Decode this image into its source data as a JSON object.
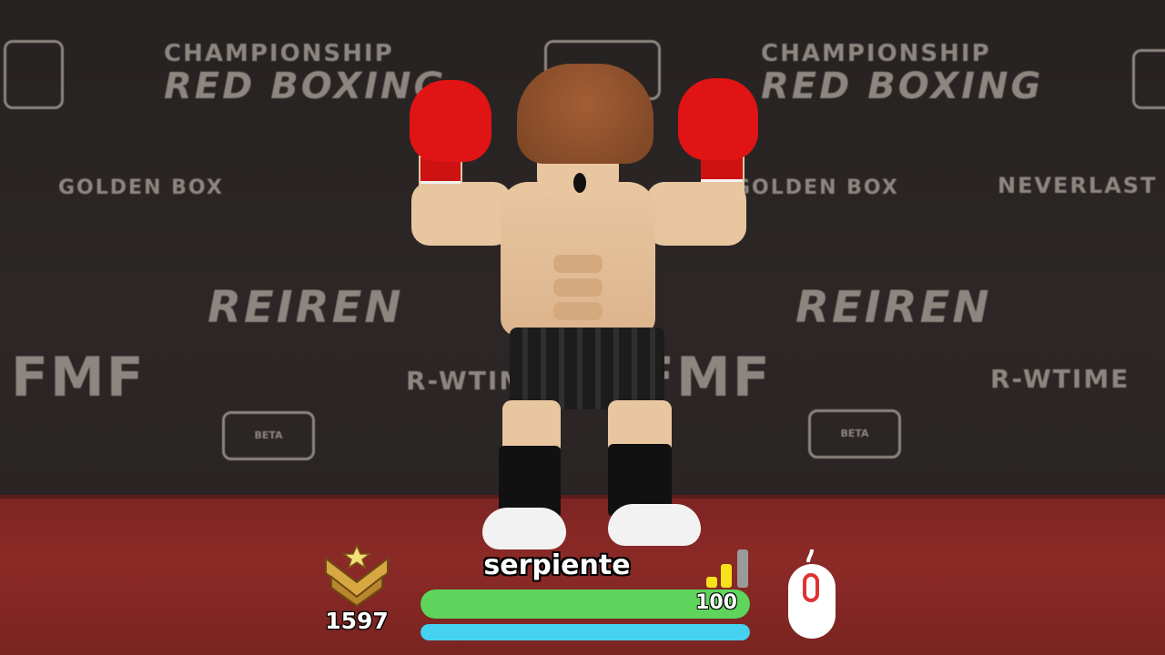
{
  "hud": {
    "rank_value": "1597",
    "player_name": "serpiente",
    "health_value": "100",
    "health_fraction": 1.0,
    "stamina_fraction": 1.0,
    "signal_bars_active": 2,
    "signal_bars_total": 3
  },
  "backdrop_logos": {
    "top_left": "CHAMPIONSHIP",
    "top_left_sub": "RED BOXING",
    "top_right": "CHAMPIONSHIP",
    "top_right_sub": "RED BOXING",
    "mid_left": "GOLDEN BOX",
    "mid_right": "GOLDEN BOX",
    "right_brand": "NEVERLAST",
    "center_left": "REIREN",
    "center_right": "REIREN",
    "fmf_left": "FMF",
    "fmf_right": "FMF",
    "showtime_left": "R-WTIME",
    "showtime_right": "R-WTIME",
    "beta_left": "BETA",
    "beta_right": "BETA"
  },
  "colors": {
    "health": "#5fd45c",
    "stamina": "#45d2f0",
    "glove": "#e01414",
    "floor": "#8b2a27",
    "rank_gold": "#d7a742",
    "signal_active": "#f5e21b",
    "signal_inactive": "#9a9a9a"
  },
  "icons": [
    "rank-chevron-icon",
    "signal-bars-icon",
    "mouse-icon"
  ]
}
